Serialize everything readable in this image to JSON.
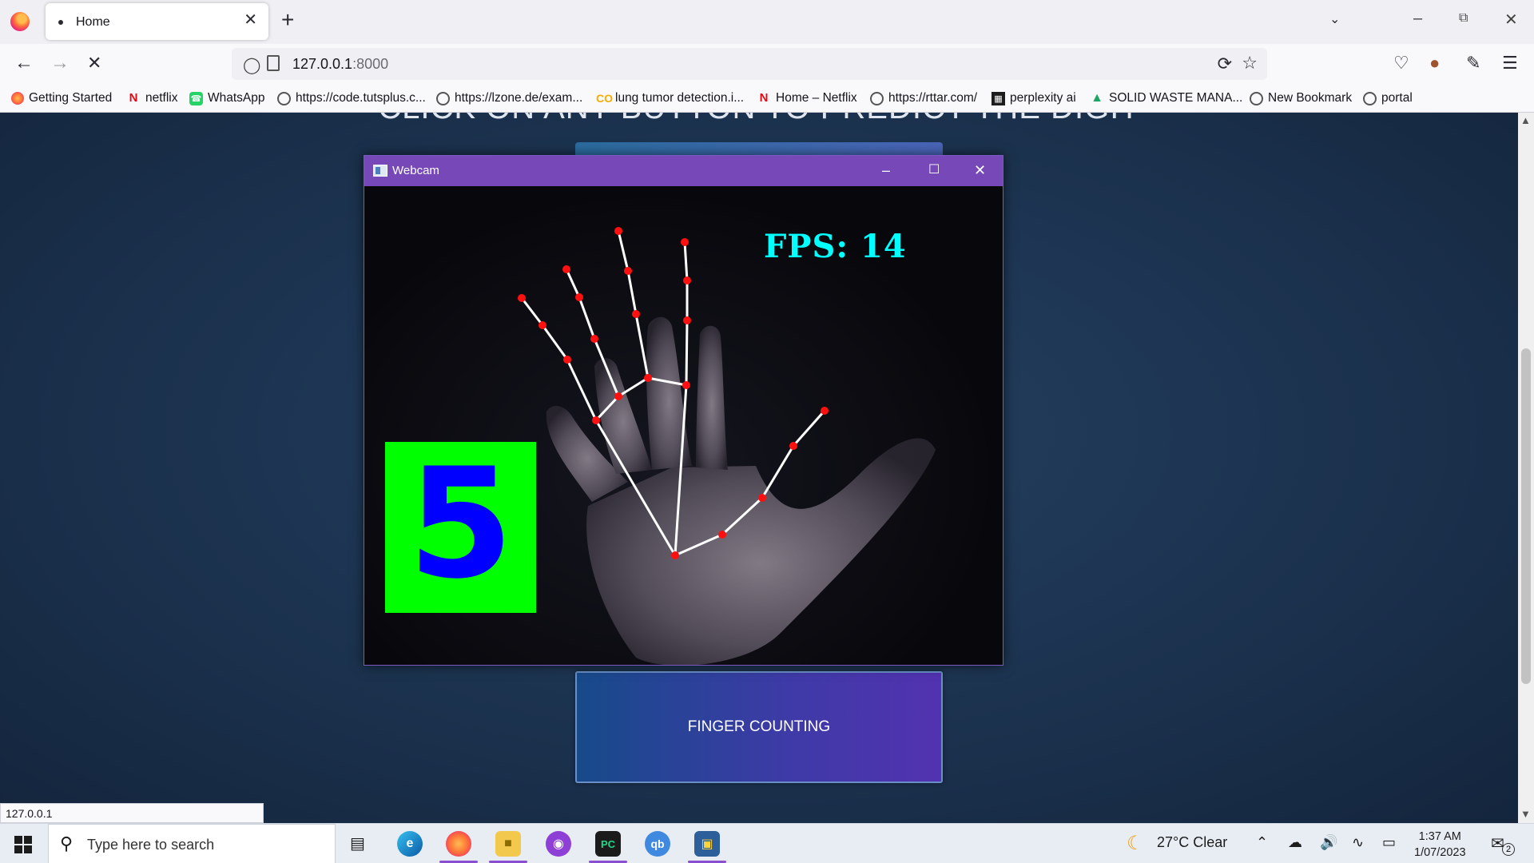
{
  "browser": {
    "tab_title": "Home",
    "new_tab": "+",
    "close": "✕",
    "url_host": "127.0.0.1",
    "url_port": ":8000",
    "status_url": "127.0.0.1",
    "bookmarks": [
      {
        "label": "Getting Started",
        "icon": "firefox-icon"
      },
      {
        "label": "netflix",
        "icon": "netflix-icon"
      },
      {
        "label": "WhatsApp",
        "icon": "whatsapp-icon"
      },
      {
        "label": "https://code.tutsplus.c...",
        "icon": "globe-icon"
      },
      {
        "label": "https://lzone.de/exam...",
        "icon": "globe-icon"
      },
      {
        "label": "lung tumor detection.i...",
        "icon": "colab-icon"
      },
      {
        "label": "Home – Netflix",
        "icon": "netflix-icon"
      },
      {
        "label": "https://rttar.com/",
        "icon": "globe-icon"
      },
      {
        "label": "perplexity ai",
        "icon": "grid-icon"
      },
      {
        "label": "SOLID WASTE MANA...",
        "icon": "drive-icon"
      },
      {
        "label": "New Bookmark",
        "icon": "globe-icon"
      },
      {
        "label": "portal",
        "icon": "globe-icon"
      }
    ]
  },
  "page": {
    "heading": "CLICK ON ANY BUTTON TO PREDICT THE DIGIT",
    "finger_button": "FINGER COUNTING"
  },
  "webcam": {
    "title": "Webcam",
    "fps_text": "FPS:  14",
    "digit": "5"
  },
  "taskbar": {
    "search_placeholder": "Type here to search",
    "weather": "27°C  Clear",
    "time": "1:37 AM",
    "date": "1/07/2023",
    "notification_count": "2"
  }
}
